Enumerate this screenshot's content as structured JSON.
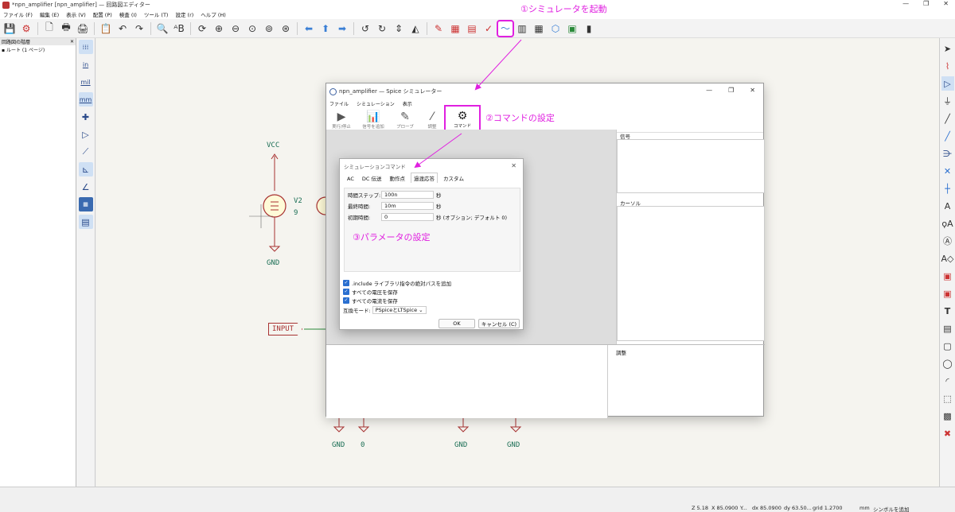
{
  "window": {
    "title": "*npn_amplifier [npn_amplifier] — 回路図エディター",
    "controls": [
      "—",
      "❐",
      "✕"
    ]
  },
  "menu": [
    "ファイル (F)",
    "編集 (E)",
    "表示 (V)",
    "配置 (P)",
    "検査 (I)",
    "ツール (T)",
    "設定 (r)",
    "ヘルプ (H)"
  ],
  "toolbar": {
    "buttons": [
      {
        "name": "save",
        "glyph": "💾"
      },
      {
        "name": "schematic-setup",
        "glyph": "⚙"
      },
      {
        "name": "new-page",
        "glyph": "🗋"
      },
      {
        "name": "print",
        "glyph": "🖶"
      },
      {
        "name": "plot",
        "glyph": "🖨"
      },
      {
        "name": "paste",
        "glyph": "📋"
      },
      {
        "name": "undo",
        "glyph": "↶"
      },
      {
        "name": "redo",
        "glyph": "↷"
      },
      {
        "name": "find",
        "glyph": "🔍"
      },
      {
        "name": "find-replace",
        "glyph": "ᴬB"
      },
      {
        "name": "refresh",
        "glyph": "⟳"
      },
      {
        "name": "zoom-in",
        "glyph": "⊕"
      },
      {
        "name": "zoom-out",
        "glyph": "⊖"
      },
      {
        "name": "zoom-fit",
        "glyph": "⊙"
      },
      {
        "name": "zoom-objects",
        "glyph": "⊚"
      },
      {
        "name": "zoom-selection",
        "glyph": "⊛"
      },
      {
        "name": "nav-back",
        "glyph": "⬅"
      },
      {
        "name": "nav-up",
        "glyph": "⬆"
      },
      {
        "name": "nav-forward",
        "glyph": "➡"
      },
      {
        "name": "rotate-ccw",
        "glyph": "↺"
      },
      {
        "name": "rotate-cw",
        "glyph": "↻"
      },
      {
        "name": "mirror-v",
        "glyph": "⇕"
      },
      {
        "name": "mirror-h",
        "glyph": "◭"
      },
      {
        "name": "symbol-editor",
        "glyph": "✎"
      },
      {
        "name": "symbol-browser",
        "glyph": "▦"
      },
      {
        "name": "annotate",
        "glyph": "▤"
      },
      {
        "name": "erc",
        "glyph": "✓"
      },
      {
        "name": "sim-launch",
        "glyph": "〜"
      },
      {
        "name": "bom",
        "glyph": "▥"
      },
      {
        "name": "fields",
        "glyph": "▦"
      },
      {
        "name": "netlist",
        "glyph": "⬡"
      },
      {
        "name": "pcb",
        "glyph": "▣"
      },
      {
        "name": "scripting",
        "glyph": "▮"
      }
    ]
  },
  "hierarchy": {
    "title": "回路図の階層",
    "root": "ルート (1 ページ)"
  },
  "left_tools": [
    "grid",
    "in",
    "mil",
    "mm",
    "cursor",
    "hidden-pins",
    "line-45",
    "line-90",
    "line-free",
    "rule-checker",
    "annotation-panel"
  ],
  "left_tool_labels": {
    "in": "in",
    "mil": "mil",
    "mm": "mm"
  },
  "right_tools": [
    "select",
    "highlight-net",
    "add-symbol",
    "add-power",
    "add-wire",
    "add-bus",
    "wire-to-bus",
    "no-connect",
    "junction",
    "label",
    "net-class",
    "global-label",
    "hier-label",
    "hier-sheet",
    "import-sheet-pin",
    "text",
    "textbox",
    "rectangle",
    "circle",
    "arc",
    "bitmap-image",
    "delete"
  ],
  "schematic": {
    "labels": {
      "vcc": "VCC",
      "v2": "V2",
      "v2_value": "9",
      "gnd": "GND",
      "input": "INPUT",
      "gnd_b1": "GND",
      "zero": "0",
      "gnd_b2": "GND",
      "gnd_b3": "GND"
    }
  },
  "simulator": {
    "title": "npn_amplifier — Spice シミュレーター",
    "menu": [
      "ファイル",
      "シミュレーション",
      "表示"
    ],
    "toolbar": [
      {
        "glyph": "▶",
        "label": "実行/停止"
      },
      {
        "glyph": "📊",
        "label": "信号を追加"
      },
      {
        "glyph": "✎",
        "label": "プローブ"
      },
      {
        "glyph": "⁄",
        "label": "調整"
      },
      {
        "glyph": "⚙",
        "label": "コマンド"
      }
    ],
    "signals_label": "信号",
    "cursors_label": "カーソル",
    "tune_label": "調整"
  },
  "dialog": {
    "title": "シミュレーションコマンド",
    "tabs": [
      "AC",
      "DC 伝送",
      "動作点",
      "過渡応答",
      "カスタム"
    ],
    "active_tab": "過渡応答",
    "fields": [
      {
        "label": "時間ステップ:",
        "value": "100n",
        "unit": "秒"
      },
      {
        "label": "最終時間:",
        "value": "10m",
        "unit": "秒"
      },
      {
        "label": "初期時間:",
        "value": "0",
        "unit": "秒 (オプション; デフォルト 0)"
      }
    ],
    "checks": [
      ".include ライブラリ指令の絶対パスを追加",
      "すべての電圧を保存",
      "すべての電流を保存"
    ],
    "compat_label": "互換モード:",
    "compat_value": "PSpiceとLTSpice",
    "ok": "OK",
    "cancel": "キャンセル (C)"
  },
  "annotations": {
    "step1": "①シミュレータを起動",
    "step2": "②コマンドの設定",
    "step3": "③パラメータの設定",
    "color": "#e020e0"
  },
  "status": {
    "z": "Z 5.18",
    "x": "X 85.0900",
    "y": "Y...",
    "dx": "dx 85.0900",
    "dy": "dy 63.50...",
    "grid": "grid 1.2700",
    "units": "mm",
    "mode": "シンボルを追加"
  }
}
